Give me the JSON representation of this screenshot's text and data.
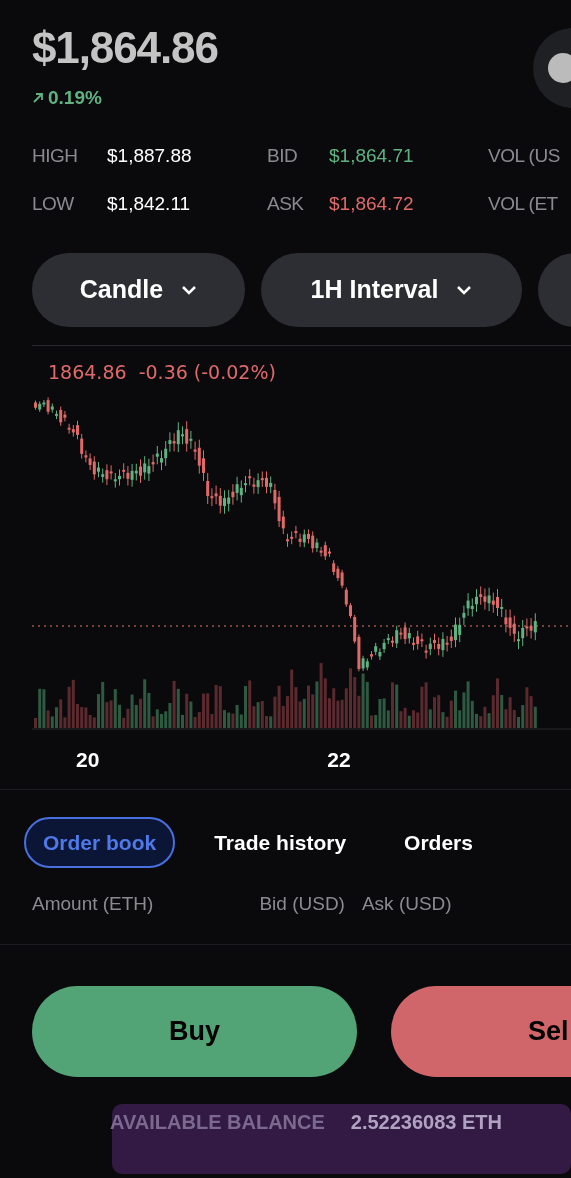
{
  "price": "$1,864.86",
  "change": {
    "text": "0.19%"
  },
  "stats": [
    {
      "label": "HIGH",
      "value": "$1,887.88",
      "color": "#ffffff"
    },
    {
      "label": "BID",
      "value": "$1,864.71",
      "color": "#5fb383"
    },
    {
      "label": "VOL (US"
    },
    {
      "label": "LOW",
      "value": "$1,842.11",
      "color": "#ffffff"
    },
    {
      "label": "ASK",
      "value": "$1,864.72",
      "color": "#e06a6a"
    },
    {
      "label": "VOL (ET"
    }
  ],
  "dropdowns": [
    {
      "label": "Candle"
    },
    {
      "label": "1H Interval"
    }
  ],
  "chart": {
    "legend": "1864.86  -0.36 (-0.02%)",
    "x_labels": [
      "20",
      "22"
    ]
  },
  "tabs": [
    {
      "label": "Order book",
      "selected": true
    },
    {
      "label": "Trade history",
      "selected": false
    },
    {
      "label": "Orders",
      "selected": false
    }
  ],
  "order_book_columns": [
    "Amount (ETH)",
    "Bid (USD)",
    "Ask (USD)"
  ],
  "actions": [
    {
      "label": "Buy",
      "kind": "buy"
    },
    {
      "label": "Sel",
      "kind": "sell"
    }
  ],
  "balance": {
    "label": "AVAILABLE BALANCE",
    "value": "2.52236083 ETH"
  }
}
